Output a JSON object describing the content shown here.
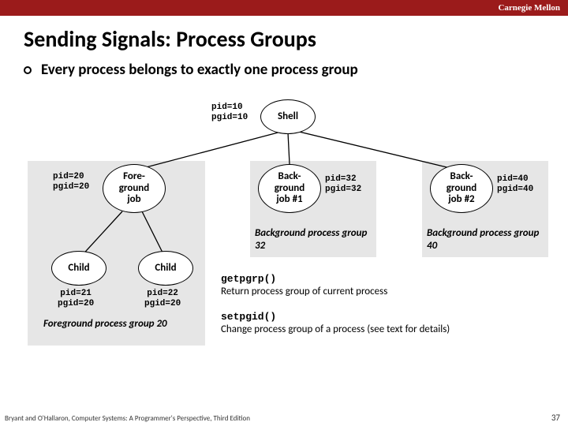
{
  "brand": "Carnegie Mellon",
  "title": "Sending Signals: Process Groups",
  "bullet": "Every process belongs to exactly one process group",
  "shell": {
    "name": "Shell",
    "pid_line1": "pid=10",
    "pid_line2": "pgid=10"
  },
  "fg": {
    "name_l1": "Fore-",
    "name_l2": "ground",
    "name_l3": "job",
    "pid_line1": "pid=20",
    "pid_line2": "pgid=20"
  },
  "bg1": {
    "name_l1": "Back-",
    "name_l2": "ground",
    "name_l3": "job #1",
    "pid_line1": "pid=32",
    "pid_line2": "pgid=32"
  },
  "bg2": {
    "name_l1": "Back-",
    "name_l2": "ground",
    "name_l3": "job #2",
    "pid_line1": "pid=40",
    "pid_line2": "pgid=40"
  },
  "child1": {
    "name": "Child",
    "pid_line1": "pid=21",
    "pid_line2": "pgid=20"
  },
  "child2": {
    "name": "Child",
    "pid_line1": "pid=22",
    "pid_line2": "pgid=20"
  },
  "captions": {
    "fg": "Foreground process group 20",
    "bg1": "Background process group 32",
    "bg2": "Background process group 40"
  },
  "funcs": {
    "getpgrp_name": "getpgrp()",
    "getpgrp_desc": "Return process group of current process",
    "setpgid_name": "setpgid()",
    "setpgid_desc": "Change process group of a process (see text for details)"
  },
  "footer": "Bryant and O'Hallaron, Computer Systems: A Programmer's Perspective, Third Edition",
  "pagenum": "37"
}
